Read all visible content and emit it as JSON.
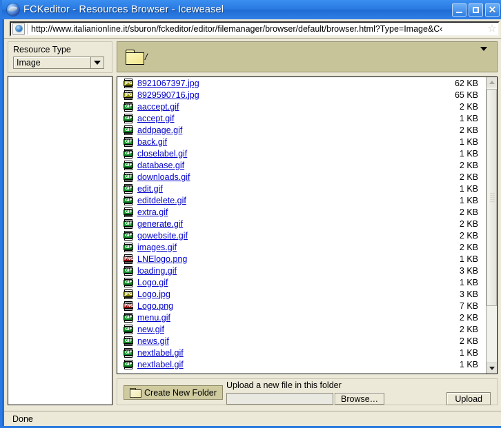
{
  "window": {
    "title": "FCKeditor - Resources Browser - Iceweasel",
    "app_icon": "iceweasel-globe-icon",
    "controls": {
      "minimize": "_",
      "maximize": "□",
      "close": "✕"
    },
    "titlebar_color": "#2a7ae2"
  },
  "navbar": {
    "site_icon": "page-globe-icon",
    "url": "http://www.italianionline.it/sburon/fckeditor/editor/filemanager/browser/default/browser.html?Type=Image&C‹",
    "star_icon": "☆"
  },
  "sidebar": {
    "resource_type_label": "Resource Type",
    "resource_type_value": "Image",
    "resource_type_options": [
      "Image"
    ],
    "dropdown_icon": "chevron-down-icon"
  },
  "folderbar": {
    "icon": "folder-icon",
    "path": "/",
    "dropdown_icon": "chevron-down-icon",
    "bg_color": "#c8c49a"
  },
  "filelist": {
    "rows": [
      {
        "name": "8921067397.jpg",
        "size": "62 KB",
        "type": "jpg"
      },
      {
        "name": "8929590716.jpg",
        "size": "65 KB",
        "type": "jpg"
      },
      {
        "name": "aaccept.gif",
        "size": "2 KB",
        "type": "gif"
      },
      {
        "name": "accept.gif",
        "size": "1 KB",
        "type": "gif"
      },
      {
        "name": "addpage.gif",
        "size": "2 KB",
        "type": "gif"
      },
      {
        "name": "back.gif",
        "size": "1 KB",
        "type": "gif"
      },
      {
        "name": "closelabel.gif",
        "size": "1 KB",
        "type": "gif"
      },
      {
        "name": "database.gif",
        "size": "2 KB",
        "type": "gif"
      },
      {
        "name": "downloads.gif",
        "size": "2 KB",
        "type": "gif"
      },
      {
        "name": "edit.gif",
        "size": "1 KB",
        "type": "gif"
      },
      {
        "name": "editdelete.gif",
        "size": "1 KB",
        "type": "gif"
      },
      {
        "name": "extra.gif",
        "size": "2 KB",
        "type": "gif"
      },
      {
        "name": "generate.gif",
        "size": "2 KB",
        "type": "gif"
      },
      {
        "name": "gowebsite.gif",
        "size": "2 KB",
        "type": "gif"
      },
      {
        "name": "images.gif",
        "size": "2 KB",
        "type": "gif"
      },
      {
        "name": "LNElogo.png",
        "size": "1 KB",
        "type": "png"
      },
      {
        "name": "loading.gif",
        "size": "3 KB",
        "type": "gif"
      },
      {
        "name": "Logo.gif",
        "size": "1 KB",
        "type": "gif"
      },
      {
        "name": "Logo.jpg",
        "size": "3 KB",
        "type": "jpg"
      },
      {
        "name": "Logo.png",
        "size": "7 KB",
        "type": "png"
      },
      {
        "name": "menu.gif",
        "size": "2 KB",
        "type": "gif"
      },
      {
        "name": "new.gif",
        "size": "2 KB",
        "type": "gif"
      },
      {
        "name": "news.gif",
        "size": "2 KB",
        "type": "gif"
      },
      {
        "name": "nextlabel.gif",
        "size": "1 KB",
        "type": "gif"
      },
      {
        "name": "nextlabel.gif",
        "size": "1 KB",
        "type": "gif"
      }
    ],
    "icon_colors": {
      "gif": "#0a8a20",
      "jpg": "#8a8a0a",
      "png": "#8a0a0a"
    },
    "link_color": "#0000cc"
  },
  "scrollbar": {
    "up_icon": "scroll-up-arrow-icon",
    "down_icon": "scroll-down-arrow-icon",
    "grip_icon": "scrollbar-grip-icon"
  },
  "uploadbar": {
    "create_folder_label": "Create New Folder",
    "create_folder_icon": "folder-icon",
    "upload_label": "Upload a new file in this folder",
    "file_input_value": "",
    "browse_label": "Browse…",
    "upload_label_button": "Upload"
  },
  "statusbar": {
    "text": "Done"
  }
}
